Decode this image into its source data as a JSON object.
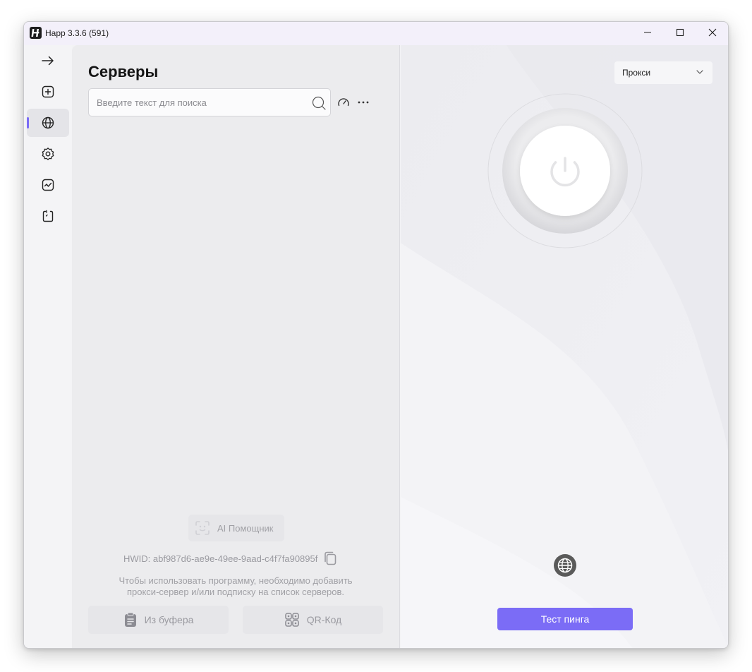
{
  "window": {
    "title": "Happ 3.3.6 (591)",
    "controls": [
      "minimize-icon",
      "maximize-icon",
      "close-icon"
    ]
  },
  "sidebar": {
    "items": [
      {
        "icon": "arrow-right-icon",
        "active": false
      },
      {
        "icon": "add-square-icon",
        "active": false
      },
      {
        "icon": "globe-icon",
        "active": true
      },
      {
        "icon": "gear-icon",
        "active": false
      },
      {
        "icon": "chart-icon",
        "active": false
      },
      {
        "icon": "clipboard-icon",
        "active": false
      }
    ],
    "info_icon": "i"
  },
  "servers": {
    "title": "Серверы",
    "search": {
      "placeholder": "Введите текст для поиска",
      "value": ""
    },
    "ai_assistant_label": "AI Помощник",
    "hwid_label": "HWID: abf987d6-ae9e-49ee-9aad-c4f7fa90895f",
    "hint_line1": "Чтобы использовать программу, необходимо добавить",
    "hint_line2": "прокси-сервер и/или подписку на список серверов.",
    "from_clipboard_label": "Из буфера",
    "qr_code_label": "QR-Код"
  },
  "connection": {
    "mode": "Прокси",
    "ping_test_label": "Тест пинга"
  },
  "colors": {
    "accent": "#7b6cf6",
    "panel": "#ececee",
    "rail": "#f4f4f6"
  }
}
